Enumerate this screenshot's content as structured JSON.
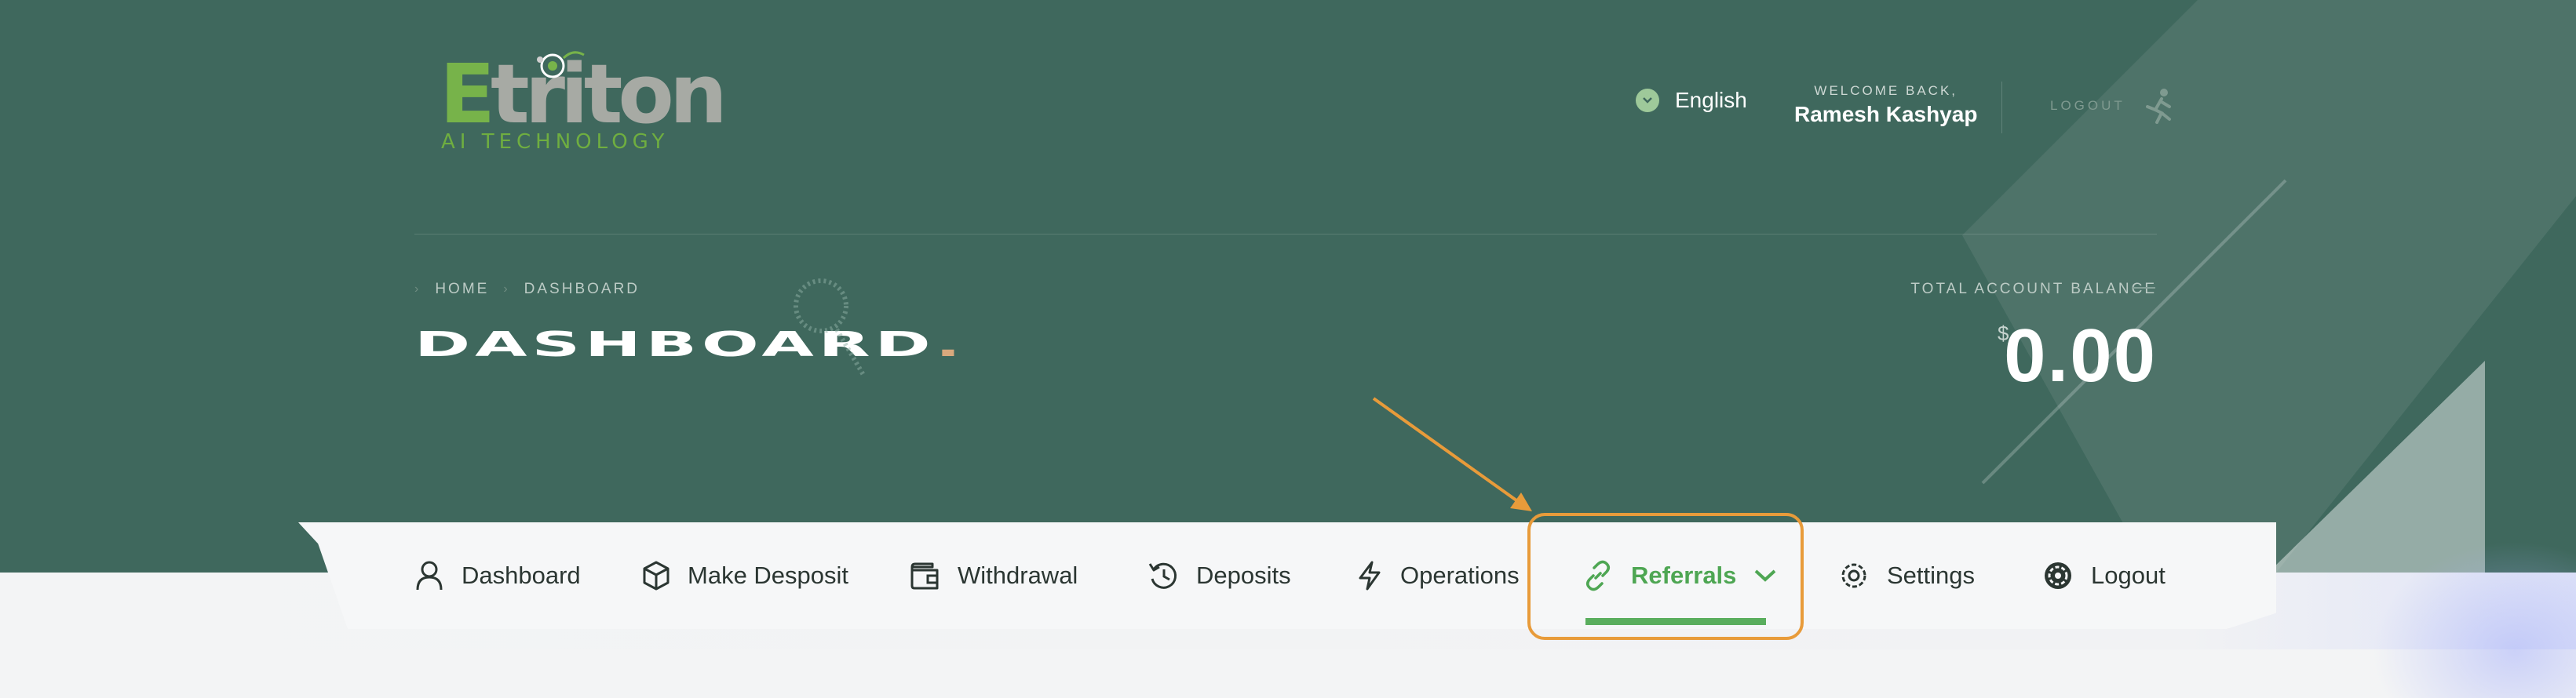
{
  "brand": {
    "logo_text": "Etriton",
    "tagline": "AI TECHNOLOGY"
  },
  "header": {
    "language": "English",
    "welcome_label": "WELCOME BACK,",
    "user_name": "Ramesh Kashyap",
    "logout_label": "LOGOUT"
  },
  "breadcrumb": {
    "home": "HOME",
    "current": "DASHBOARD"
  },
  "page": {
    "title": "DASHBOARD",
    "title_suffix": "."
  },
  "balance": {
    "label": "TOTAL ACCOUNT BALANCE",
    "currency": "$",
    "value": "0.00"
  },
  "nav": {
    "items": [
      {
        "label": "Dashboard",
        "icon": "user-icon"
      },
      {
        "label": "Make Desposit",
        "icon": "box-icon"
      },
      {
        "label": "Withdrawal",
        "icon": "wallet-icon"
      },
      {
        "label": "Deposits",
        "icon": "history-icon"
      },
      {
        "label": "Operations",
        "icon": "lightning-icon"
      },
      {
        "label": "Referrals",
        "icon": "link-icon",
        "active": true
      },
      {
        "label": "Settings",
        "icon": "gear-icon"
      },
      {
        "label": "Logout",
        "icon": "gear-icon"
      }
    ]
  },
  "colors": {
    "hero": "#3f685d",
    "accent_green": "#4ea653",
    "highlight_orange": "#e89b3a"
  }
}
